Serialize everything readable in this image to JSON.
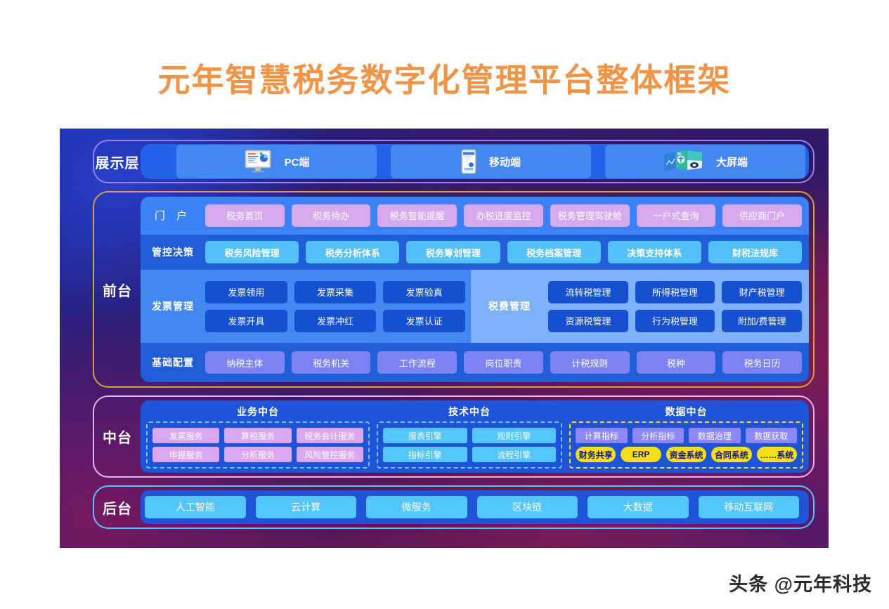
{
  "title": "元年智慧税务数字化管理平台整体框架",
  "accent_color": "#F09448",
  "watermark": "头条 @元年科技",
  "layers": {
    "display": {
      "label": "展示层",
      "border_color": "#9a7ff0",
      "items": [
        {
          "label": "PC端",
          "icon": "desktop-monitor-icon"
        },
        {
          "label": "移动端",
          "icon": "smartphone-icon"
        },
        {
          "label": "大屏端",
          "icon": "video-wall-icon"
        }
      ]
    },
    "front": {
      "label": "前台",
      "border_color": "#d3a13a",
      "rows": {
        "portal": {
          "label": "门 户",
          "chip_color": "#d6a9ef",
          "items": [
            "税务首页",
            "税务待办",
            "税务智能提醒",
            "办税进度监控",
            "税务管理驾驶舱",
            "一户式查询",
            "供应商门户"
          ]
        },
        "control": {
          "label": "管控决策",
          "chip_color": "#53c0fb",
          "items": [
            "税务风险管理",
            "税务分析体系",
            "税务筹划管理",
            "税务档案管理",
            "决策支持体系",
            "财税法规库"
          ]
        },
        "invoice": {
          "label": "发票管理",
          "chip_color": "#1550d0",
          "rows": [
            [
              "发票领用",
              "发票采集",
              "发票验真"
            ],
            [
              "发票开具",
              "发票冲红",
              "发票认证"
            ]
          ]
        },
        "tax_fee": {
          "label": "税费管理",
          "chip_color": "#1550d0",
          "rows": [
            [
              "流转税管理",
              "所得税管理",
              "财产税管理"
            ],
            [
              "资源税管理",
              "行为税管理",
              "附加/费管理"
            ]
          ]
        },
        "basic": {
          "label": "基础配置",
          "chip_color": "#7d82f5",
          "items": [
            "纳税主体",
            "税务机关",
            "工作流程",
            "岗位职责",
            "计税规则",
            "税种",
            "税务日历"
          ]
        }
      }
    },
    "middle": {
      "label": "中台",
      "border_color": "#e2b6f5",
      "columns": [
        {
          "title": "业务中台",
          "box_border": "#6fc9f5",
          "rows": [
            [
              "发票服务",
              "算税服务",
              "税务会计服务"
            ],
            [
              "申报服务",
              "分析服务",
              "风险管控服务"
            ]
          ]
        },
        {
          "title": "技术中台",
          "box_border": "#6fc9f5",
          "rows": [
            [
              "报表引擎",
              "规则引擎"
            ],
            [
              "指标引擎",
              "流程引擎"
            ]
          ]
        },
        {
          "title": "数据中台",
          "box_border": "#f2e416",
          "rows": [
            [
              "计算指标",
              "分析指标",
              "数据治理",
              "数据获取"
            ],
            [
              "财务共享",
              "ERP",
              "资金系统",
              "合同系统",
              "……系统"
            ]
          ]
        }
      ]
    },
    "back": {
      "label": "后台",
      "border_color": "#54c6fb",
      "chip_color": "#54c6fb",
      "items": [
        "人工智能",
        "云计算",
        "微服务",
        "区块链",
        "大数据",
        "移动互联网"
      ]
    }
  }
}
